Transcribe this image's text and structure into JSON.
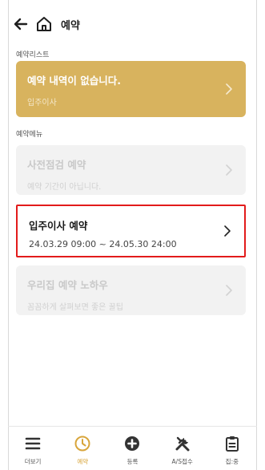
{
  "header": {
    "title": "예약"
  },
  "sections": {
    "reservation_list_label": "예약리스트",
    "reservation_menu_label": "예약메뉴"
  },
  "reservation_list": {
    "title": "예약 내역이 없습니다.",
    "subtitle": "입주이사"
  },
  "menu": [
    {
      "title": "사전점검 예약",
      "subtitle": "예약 기간이 아닙니다."
    },
    {
      "title": "입주이사 예약",
      "subtitle": "24.03.29 09:00 ~ 24.05.30 24:00"
    },
    {
      "title": "우리집 예약 노하우",
      "subtitle": "꼼꼼하게 살펴보면 좋은 꿀팁"
    }
  ],
  "bottom_nav": [
    {
      "label": "더보기",
      "icon": "menu-icon"
    },
    {
      "label": "예약",
      "icon": "clock-icon"
    },
    {
      "label": "등록",
      "icon": "plus-circle-icon"
    },
    {
      "label": "A/S접수",
      "icon": "tools-icon"
    },
    {
      "label": "집:중",
      "icon": "clipboard-icon"
    }
  ],
  "colors": {
    "accent": "#d8b35e",
    "active_nav": "#d8a53b",
    "highlight_border": "#e21b1b"
  }
}
